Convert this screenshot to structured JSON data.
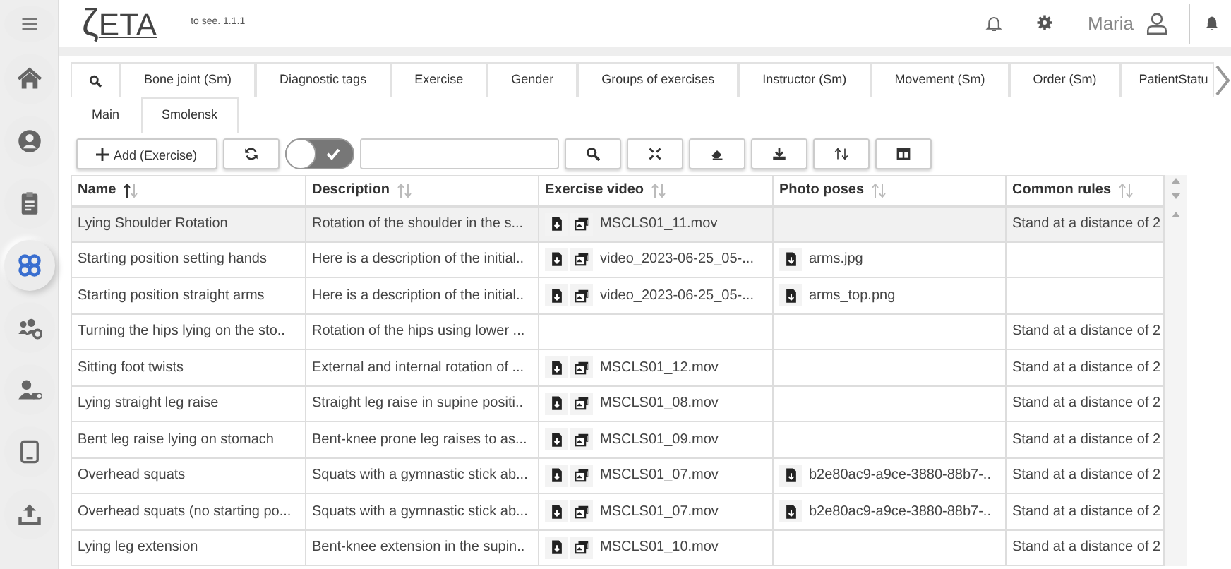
{
  "sidebar": {
    "items": [
      {
        "selected": false
      },
      {
        "selected": false
      },
      {
        "selected": false
      },
      {
        "selected": false
      },
      {
        "selected": true
      },
      {
        "selected": false
      },
      {
        "selected": false
      },
      {
        "selected": false
      },
      {
        "selected": false
      }
    ]
  },
  "header": {
    "logo_letter": "ζ",
    "logo_name": "ETA",
    "version": "to see. 1.1.1",
    "user": "Maria"
  },
  "tabs": [
    {
      "kind": "search",
      "selected": false
    },
    {
      "kind": "text",
      "label": "Bone joint (Sm)",
      "selected": false
    },
    {
      "kind": "text",
      "label": "Diagnostic tags",
      "selected": false
    },
    {
      "kind": "text",
      "label": "Exercise",
      "selected": false
    },
    {
      "kind": "text",
      "label": "Gender",
      "selected": false
    },
    {
      "kind": "text",
      "label": "Groups of exercises",
      "selected": false
    },
    {
      "kind": "text",
      "label": "Instructor (Sm)",
      "selected": false
    },
    {
      "kind": "text",
      "label": "Movement (Sm)",
      "selected": false
    },
    {
      "kind": "text",
      "label": "Order (Sm)",
      "selected": false
    },
    {
      "kind": "text",
      "label": "PatientStatu",
      "selected": false
    }
  ],
  "tabs_row_2": [
    {
      "label": "Main",
      "selected": true
    },
    {
      "label": "Smolensk",
      "selected": false
    }
  ],
  "toolbar": {
    "add_button": "Add (Exercise)",
    "toggle": {
      "on": true
    }
  },
  "table": {
    "columns": [
      {
        "label": "Name",
        "sorted": true
      },
      {
        "label": "Description",
        "sorted": false
      },
      {
        "label": "Exercise video",
        "sorted": false
      },
      {
        "label": "Photo poses",
        "sorted": false
      },
      {
        "label": "Common rules",
        "sorted": false
      }
    ],
    "rows": [
      {
        "selected": true,
        "name": "Lying Shoulder Rotation",
        "description": "Rotation of the shoulder in the s...",
        "video": "MSCLS01_11.mov",
        "rules": "Stand at a distance of 2"
      },
      {
        "selected": false,
        "name": "Starting position setting hands",
        "description": "Here is a description of the initial..",
        "video": "video_2023-06-25_05-...",
        "photo": "arms.jpg"
      },
      {
        "selected": false,
        "name": "Starting position straight arms",
        "description": "Here is a description of the initial..",
        "video": "video_2023-06-25_05-...",
        "photo": "arms_top.png"
      },
      {
        "selected": false,
        "name": "Turning the hips lying on the sto..",
        "description": "Rotation of the hips using lower ...",
        "rules": "Stand at a distance of 2"
      },
      {
        "selected": false,
        "name": "Sitting foot twists",
        "description": "External and internal rotation of ...",
        "video": "MSCLS01_12.mov",
        "rules": "Stand at a distance of 2"
      },
      {
        "selected": false,
        "name": "Lying straight leg raise",
        "description": "Straight leg raise in supine positi..",
        "video": "MSCLS01_08.mov",
        "rules": "Stand at a distance of 2"
      },
      {
        "selected": false,
        "name": "Bent leg raise lying on stomach",
        "description": "Bent-knee prone leg raises to as...",
        "video": "MSCLS01_09.mov",
        "rules": "Stand at a distance of 2"
      },
      {
        "selected": false,
        "name": "Overhead squats",
        "description": "Squats with a gymnastic stick ab...",
        "video": "MSCLS01_07.mov",
        "photo": "b2e80ac9-a9ce-3880-88b7-..",
        "rules": "Stand at a distance of 2"
      },
      {
        "selected": false,
        "name": "Overhead squats (no starting po...",
        "description": "Squats with a gymnastic stick ab...",
        "video": "MSCLS01_07.mov",
        "photo": "b2e80ac9-a9ce-3880-88b7-..",
        "rules": "Stand at a distance of 2"
      },
      {
        "selected": false,
        "name": "Lying leg extension",
        "description": "Bent-knee extension in the supin..",
        "video": "MSCLS01_10.mov",
        "rules": "Stand at a distance of 2"
      }
    ]
  }
}
